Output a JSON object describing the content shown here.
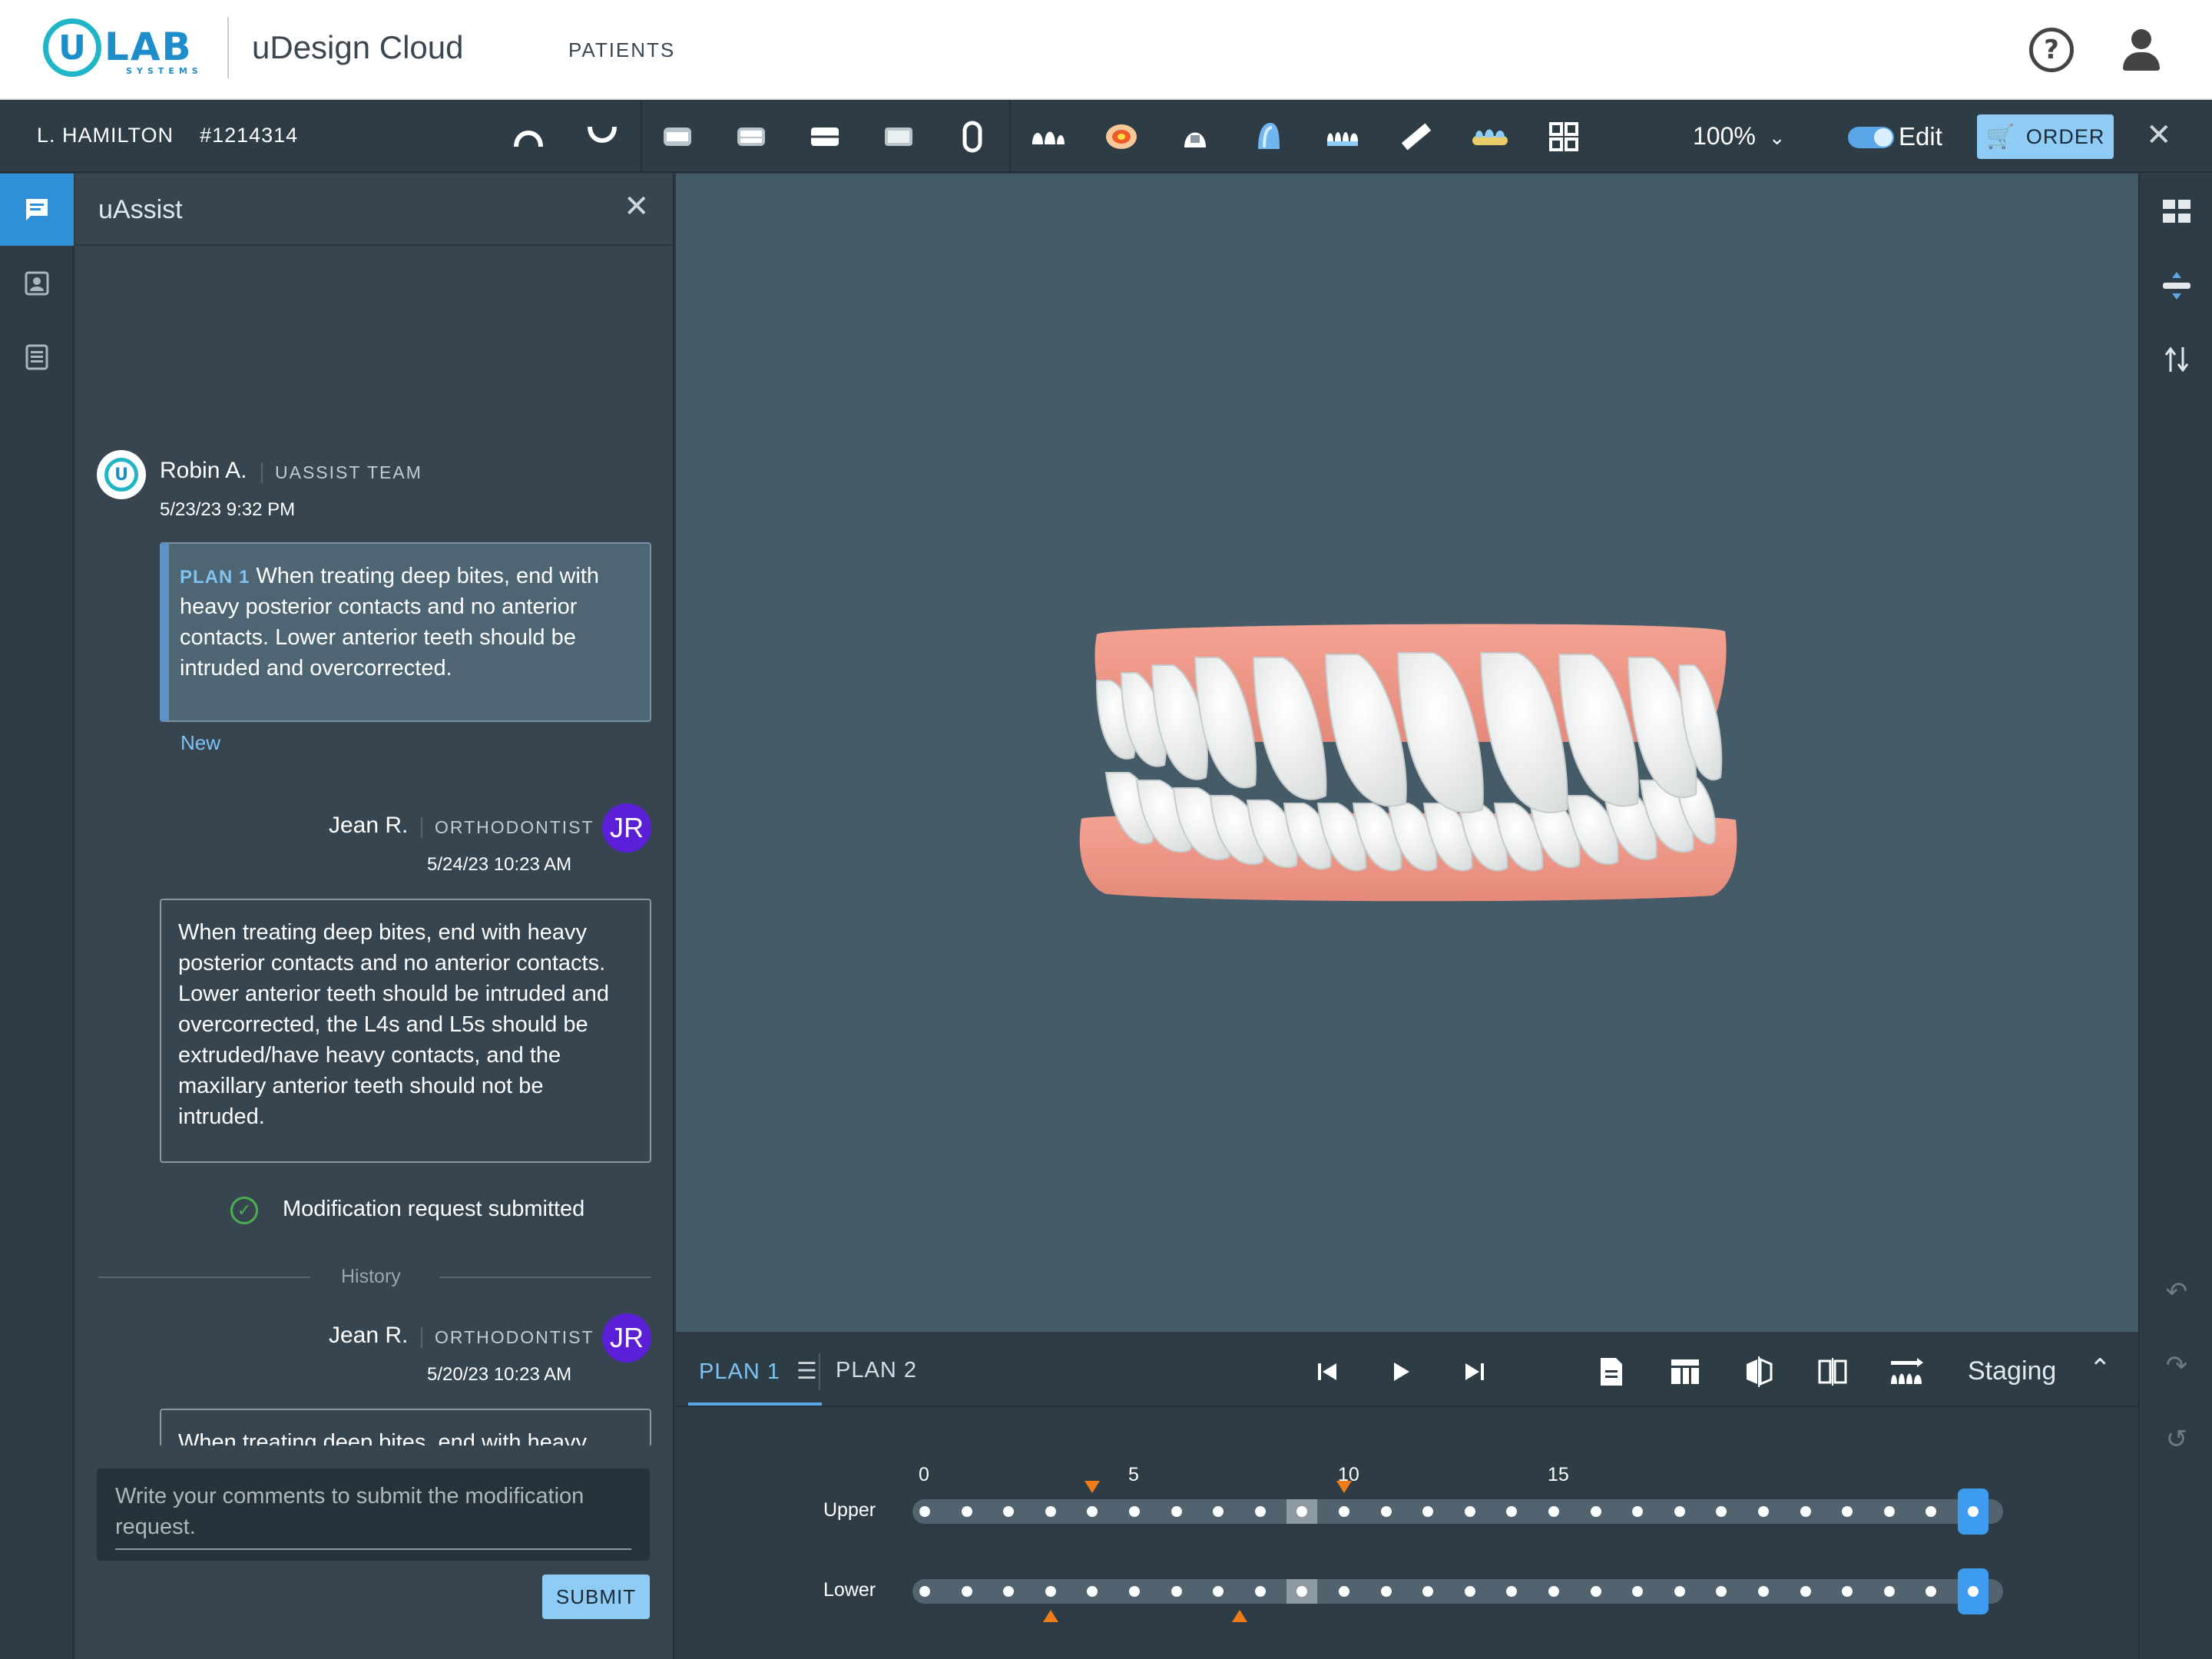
{
  "header": {
    "logo_main": "LAB",
    "logo_u": "U",
    "logo_sub": "SYSTEMS",
    "app_title": "uDesign Cloud",
    "nav": [
      "PATIENTS"
    ]
  },
  "toolbar": {
    "patient_name": "L. HAMILTON",
    "patient_id": "#1214314",
    "zoom": "100%",
    "edit_label": "Edit",
    "edit_enabled": true,
    "order_label": "ORDER",
    "colors": {
      "accent": "#5ba6e8",
      "order_bg": "#8ecbf5",
      "toolbar_bg": "#2e3c46"
    }
  },
  "left_rail": {
    "items": [
      {
        "icon": "chat-icon",
        "active": true
      },
      {
        "icon": "patient-record-icon",
        "active": false
      },
      {
        "icon": "document-list-icon",
        "active": false
      }
    ]
  },
  "uassist": {
    "title": "uAssist",
    "messages": [
      {
        "author": "Robin A.",
        "role": "UASSIST TEAM",
        "time": "5/23/23 9:32 PM",
        "plan_tag": "PLAN 1",
        "text": "When treating deep bites, end with heavy posterior contacts and no anterior contacts. Lower anterior teeth should be intruded and overcorrected.",
        "badge": "New"
      },
      {
        "author": "Jean R.",
        "role": "ORTHODONTIST",
        "initials": "JR",
        "time": "5/24/23 10:23 AM",
        "text": "When treating deep bites, end with heavy posterior contacts and no anterior contacts. Lower anterior teeth should be intruded and overcorrected, the L4s and L5s should be extruded/have heavy contacts, and the maxillary anterior teeth should not be intruded.",
        "status": "Modification request submitted"
      }
    ],
    "history_label": "History",
    "history": [
      {
        "author": "Jean R.",
        "role": "ORTHODONTIST",
        "initials": "JR",
        "time": "5/20/23 10:23 AM",
        "text": "When treating deep bites, end with heavy posterior contacts and no anterior contacts. Lower anterior teeth should be intruded and overcorrected, the L4s and L5s should be extruded/have heavy contacts, and the maxillary anterior teeth"
      }
    ],
    "compose_placeholder": "Write your comments to submit the modification request.",
    "submit_label": "SUBMIT"
  },
  "bottom_panel": {
    "tabs": [
      {
        "label": "PLAN 1",
        "active": true
      },
      {
        "label": "PLAN 2",
        "active": false
      }
    ],
    "staging_label": "Staging",
    "ticks": [
      "0",
      "5",
      "10",
      "15"
    ],
    "rows": [
      {
        "label": "Upper",
        "stages": 25,
        "current_stage": 9,
        "markers": [
          4,
          10
        ]
      },
      {
        "label": "Lower",
        "stages": 25,
        "current_stage": 9,
        "markers": [
          3,
          7.5
        ]
      }
    ],
    "colors": {
      "marker": "#f07c1a",
      "endcap": "#3d9bf0"
    }
  }
}
